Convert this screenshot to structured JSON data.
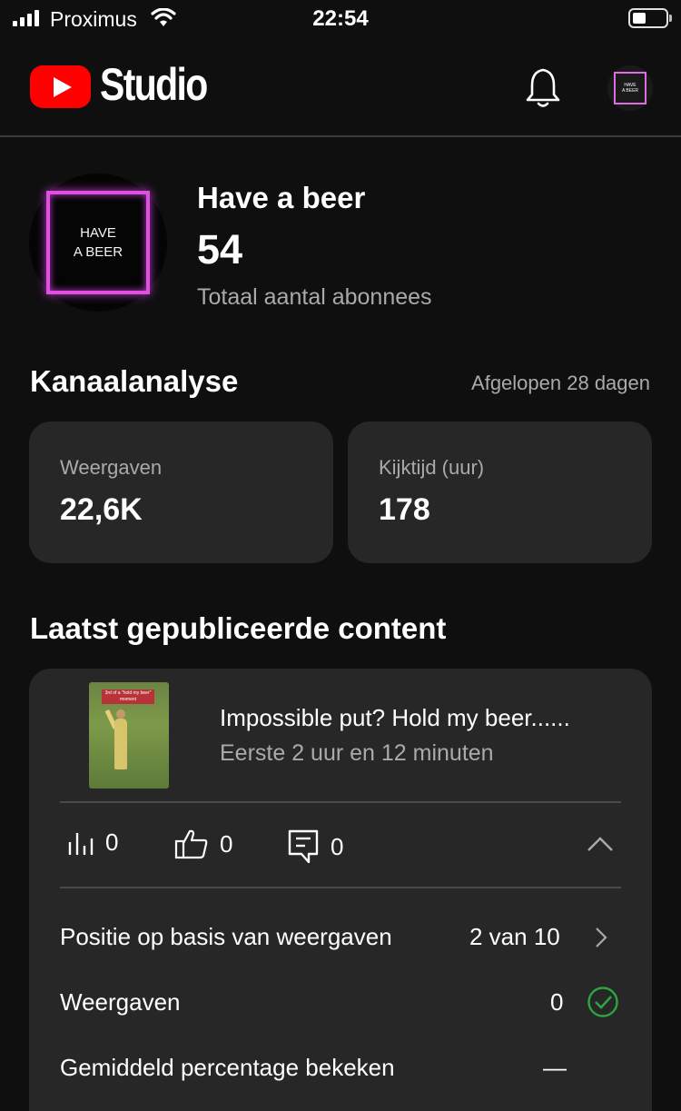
{
  "status_bar": {
    "carrier": "Proximus",
    "time": "22:54"
  },
  "header": {
    "app_name": "Studio",
    "avatar_text_line1": "HAVE",
    "avatar_text_line2": "A BEER"
  },
  "channel": {
    "avatar_line1": "HAVE",
    "avatar_line2": "A BEER",
    "name": "Have a beer",
    "subscriber_count": "54",
    "subscriber_label": "Totaal aantal abonnees"
  },
  "analytics": {
    "title": "Kanaalanalyse",
    "period": "Afgelopen 28 dagen",
    "metrics": [
      {
        "label": "Weergaven",
        "value": "22,6K"
      },
      {
        "label": "Kijktijd (uur)",
        "value": "178"
      }
    ]
  },
  "latest": {
    "title": "Laatst gepubliceerde content",
    "video": {
      "thumbnail_caption": "3rd of a \"hold my beer\" moment",
      "title": "Impossible put? Hold my beer......",
      "subtitle": "Eerste 2 uur en 12 minuten",
      "views": "0",
      "likes": "0",
      "comments": "0"
    },
    "rows": [
      {
        "label": "Positie op basis van weergaven",
        "value": "2 van 10"
      },
      {
        "label": "Weergaven",
        "value": "0"
      },
      {
        "label": "Gemiddeld percentage bekeken",
        "value": "—"
      }
    ]
  },
  "colors": {
    "background": "#0f0f0f",
    "card": "#272727",
    "youtube_red": "#ff0000",
    "accent_magenta": "#e04fe2",
    "success_green": "#2ba640"
  }
}
